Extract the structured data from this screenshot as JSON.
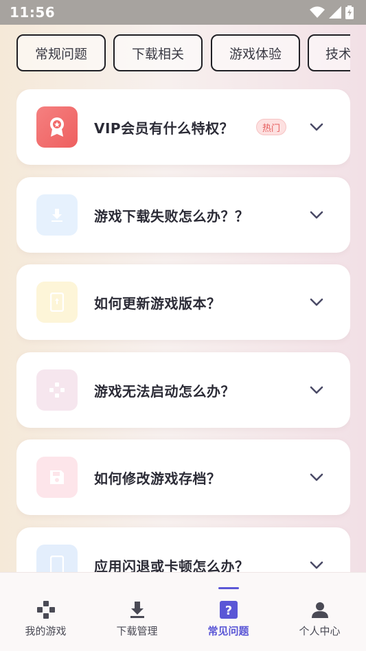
{
  "status_bar": {
    "time": "11:56"
  },
  "chips": [
    "常规问题",
    "下载相关",
    "游戏体验",
    "技术"
  ],
  "faq": [
    {
      "title": "VIP会员有什么特权？",
      "badge": "热门",
      "icon": "badge-award-icon",
      "icon_bg": "#f26a6a"
    },
    {
      "title": "游戏下载失败怎么办？？",
      "icon": "download-icon",
      "icon_bg": "#e6f1fd"
    },
    {
      "title": "如何更新游戏版本？",
      "icon": "phone-update-icon",
      "icon_bg": "#fdf5d8"
    },
    {
      "title": "游戏无法启动怎么办？",
      "icon": "gamepad-icon",
      "icon_bg": "#f6e6ee"
    },
    {
      "title": "如何修改游戏存档？",
      "icon": "save-icon",
      "icon_bg": "#fde5ea"
    },
    {
      "title": "应用闪退或卡顿怎么办？",
      "icon": "mobile-icon",
      "icon_bg": "#e3eefc"
    }
  ],
  "nav": {
    "items": [
      {
        "label": "我的游戏",
        "icon": "gamepad-icon"
      },
      {
        "label": "下载管理",
        "icon": "download-icon"
      },
      {
        "label": "常见问题",
        "icon": "question-icon"
      },
      {
        "label": "个人中心",
        "icon": "person-icon"
      }
    ],
    "active_index": 2,
    "accent": "#5a56d6"
  }
}
